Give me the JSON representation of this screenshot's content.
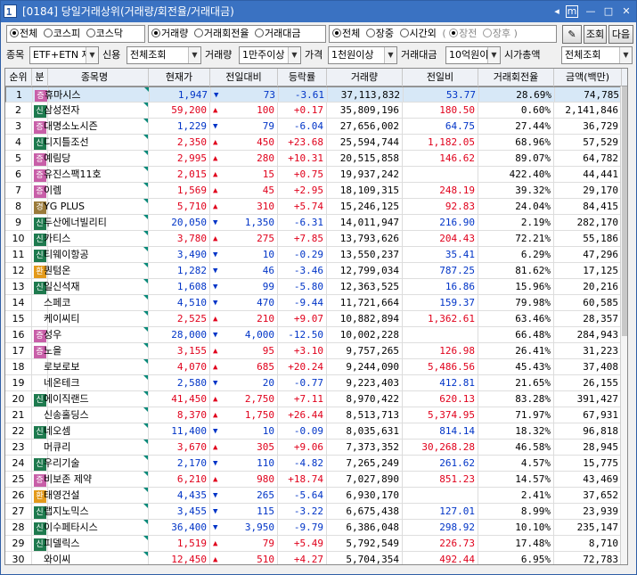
{
  "window": {
    "number": "1",
    "title": "[0184] 당일거래상위(거래량/회전율/거래대금)",
    "controls": [
      "◂",
      "▸",
      "m",
      "—",
      "□",
      "✕"
    ]
  },
  "market_group": {
    "options": [
      "전체",
      "코스피",
      "코스닥"
    ],
    "selected": 0
  },
  "sort_group": {
    "options": [
      "거래량",
      "거래회전율",
      "거래대금"
    ],
    "selected": 0
  },
  "session_group": {
    "options": [
      "전체",
      "장중",
      "시간외"
    ],
    "selected": 0
  },
  "sub_session": {
    "open": "(",
    "options": [
      "장전",
      "장후"
    ],
    "close": ")"
  },
  "buttons": {
    "settings_icon": "✎",
    "search": "조회",
    "next": "다음"
  },
  "filters": {
    "item_label": "종목",
    "item_value": "ETF+ETN 제",
    "credit_label": "신용",
    "credit_value": "전체조회",
    "volume_label": "거래량",
    "volume_value": "1만주이상",
    "price_label": "가격",
    "price_value": "1천원이상",
    "amount_label": "거래대금",
    "amount_value": "10억원이상",
    "cap_label": "시가총액",
    "cap_value": "전체조회"
  },
  "columns": [
    "순위",
    "분",
    "종목명",
    "현재가",
    "전일대비",
    "등락률",
    "거래량",
    "전일비",
    "거래회전율",
    "금액(백만)"
  ],
  "colors": {
    "up": "#e0001b",
    "down": "#0034c7",
    "badge_jeung": "#c85fa8",
    "badge_sin": "#1e7a4e",
    "badge_gyeong": "#9a7a3a",
    "badge_hwan": "#e39a1b"
  },
  "rows": [
    {
      "rank": "1",
      "badge": "증",
      "name": "휴마시스",
      "price": "1,947",
      "dir": "down",
      "change": "73",
      "rate": "-3.61",
      "volume": "37,113,832",
      "prev_ratio": "53.77",
      "turnover": "28.69%",
      "amount": "74,785"
    },
    {
      "rank": "2",
      "badge": "신",
      "name": "삼성전자",
      "price": "59,200",
      "dir": "up",
      "change": "100",
      "rate": "+0.17",
      "volume": "35,809,196",
      "prev_ratio": "180.50",
      "turnover": "0.60%",
      "amount": "2,141,846"
    },
    {
      "rank": "3",
      "badge": "증",
      "name": "대명소노시즌",
      "price": "1,229",
      "dir": "down",
      "change": "79",
      "rate": "-6.04",
      "volume": "27,656,002",
      "prev_ratio": "64.75",
      "turnover": "27.44%",
      "amount": "36,729"
    },
    {
      "rank": "4",
      "badge": "신",
      "name": "디지틀조선",
      "price": "2,350",
      "dir": "up",
      "change": "450",
      "rate": "+23.68",
      "volume": "25,594,744",
      "prev_ratio": "1,182.05",
      "turnover": "68.96%",
      "amount": "57,529"
    },
    {
      "rank": "5",
      "badge": "증",
      "name": "예림당",
      "price": "2,995",
      "dir": "up",
      "change": "280",
      "rate": "+10.31",
      "volume": "20,515,858",
      "prev_ratio": "146.62",
      "turnover": "89.07%",
      "amount": "64,782"
    },
    {
      "rank": "6",
      "badge": "증",
      "name": "유진스팩11호",
      "price": "2,015",
      "dir": "up",
      "change": "15",
      "rate": "+0.75",
      "volume": "19,937,242",
      "prev_ratio": "",
      "turnover": "422.40%",
      "amount": "44,441"
    },
    {
      "rank": "7",
      "badge": "증",
      "name": "이렘",
      "price": "1,569",
      "dir": "up",
      "change": "45",
      "rate": "+2.95",
      "volume": "18,109,315",
      "prev_ratio": "248.19",
      "turnover": "39.32%",
      "amount": "29,170"
    },
    {
      "rank": "8",
      "badge": "경",
      "name": "YG PLUS",
      "price": "5,710",
      "dir": "up",
      "change": "310",
      "rate": "+5.74",
      "volume": "15,246,125",
      "prev_ratio": "92.83",
      "turnover": "24.04%",
      "amount": "84,415"
    },
    {
      "rank": "9",
      "badge": "신",
      "name": "두산에너빌리티",
      "price": "20,050",
      "dir": "down",
      "change": "1,350",
      "rate": "-6.31",
      "volume": "14,011,947",
      "prev_ratio": "216.90",
      "turnover": "2.19%",
      "amount": "282,170"
    },
    {
      "rank": "10",
      "badge": "신",
      "name": "카티스",
      "price": "3,780",
      "dir": "up",
      "change": "275",
      "rate": "+7.85",
      "volume": "13,793,626",
      "prev_ratio": "204.43",
      "turnover": "72.21%",
      "amount": "55,186"
    },
    {
      "rank": "11",
      "badge": "신",
      "name": "티웨이항공",
      "price": "3,490",
      "dir": "down",
      "change": "10",
      "rate": "-0.29",
      "volume": "13,550,237",
      "prev_ratio": "35.41",
      "turnover": "6.29%",
      "amount": "47,296"
    },
    {
      "rank": "12",
      "badge": "환",
      "name": "퀀텀온",
      "price": "1,282",
      "dir": "down",
      "change": "46",
      "rate": "-3.46",
      "volume": "12,799,034",
      "prev_ratio": "787.25",
      "turnover": "81.62%",
      "amount": "17,125"
    },
    {
      "rank": "13",
      "badge": "신",
      "name": "일신석재",
      "price": "1,608",
      "dir": "down",
      "change": "99",
      "rate": "-5.80",
      "volume": "12,363,525",
      "prev_ratio": "16.86",
      "turnover": "15.96%",
      "amount": "20,216"
    },
    {
      "rank": "14",
      "badge": "",
      "name": "스페코",
      "price": "4,510",
      "dir": "down",
      "change": "470",
      "rate": "-9.44",
      "volume": "11,721,664",
      "prev_ratio": "159.37",
      "turnover": "79.98%",
      "amount": "60,585"
    },
    {
      "rank": "15",
      "badge": "",
      "name": "케이씨티",
      "price": "2,525",
      "dir": "up",
      "change": "210",
      "rate": "+9.07",
      "volume": "10,882,894",
      "prev_ratio": "1,362.61",
      "turnover": "63.46%",
      "amount": "28,357"
    },
    {
      "rank": "16",
      "badge": "증",
      "name": "성우",
      "price": "28,000",
      "dir": "down",
      "change": "4,000",
      "rate": "-12.50",
      "volume": "10,002,228",
      "prev_ratio": "",
      "turnover": "66.48%",
      "amount": "284,943"
    },
    {
      "rank": "17",
      "badge": "증",
      "name": "노을",
      "price": "3,155",
      "dir": "up",
      "change": "95",
      "rate": "+3.10",
      "volume": "9,757,265",
      "prev_ratio": "126.98",
      "turnover": "26.41%",
      "amount": "31,223"
    },
    {
      "rank": "18",
      "badge": "",
      "name": "로보로보",
      "price": "4,070",
      "dir": "up",
      "change": "685",
      "rate": "+20.24",
      "volume": "9,244,090",
      "prev_ratio": "5,486.56",
      "turnover": "45.43%",
      "amount": "37,408"
    },
    {
      "rank": "19",
      "badge": "",
      "name": "네온테크",
      "price": "2,580",
      "dir": "down",
      "change": "20",
      "rate": "-0.77",
      "volume": "9,223,403",
      "prev_ratio": "412.81",
      "turnover": "21.65%",
      "amount": "26,155"
    },
    {
      "rank": "20",
      "badge": "신",
      "name": "에이직랜드",
      "price": "41,450",
      "dir": "up",
      "change": "2,750",
      "rate": "+7.11",
      "volume": "8,970,422",
      "prev_ratio": "620.13",
      "turnover": "83.28%",
      "amount": "391,427"
    },
    {
      "rank": "21",
      "badge": "",
      "name": "신송홀딩스",
      "price": "8,370",
      "dir": "up",
      "change": "1,750",
      "rate": "+26.44",
      "volume": "8,513,713",
      "prev_ratio": "5,374.95",
      "turnover": "71.97%",
      "amount": "67,931"
    },
    {
      "rank": "22",
      "badge": "신",
      "name": "네오셈",
      "price": "11,400",
      "dir": "down",
      "change": "10",
      "rate": "-0.09",
      "volume": "8,035,631",
      "prev_ratio": "814.14",
      "turnover": "18.32%",
      "amount": "96,818"
    },
    {
      "rank": "23",
      "badge": "",
      "name": "머큐리",
      "price": "3,670",
      "dir": "up",
      "change": "305",
      "rate": "+9.06",
      "volume": "7,373,352",
      "prev_ratio": "30,268.28",
      "turnover": "46.58%",
      "amount": "28,945"
    },
    {
      "rank": "24",
      "badge": "신",
      "name": "우리기술",
      "price": "2,170",
      "dir": "down",
      "change": "110",
      "rate": "-4.82",
      "volume": "7,265,249",
      "prev_ratio": "261.62",
      "turnover": "4.57%",
      "amount": "15,775"
    },
    {
      "rank": "25",
      "badge": "증",
      "name": "비보존 제약",
      "price": "6,210",
      "dir": "up",
      "change": "980",
      "rate": "+18.74",
      "volume": "7,027,890",
      "prev_ratio": "851.23",
      "turnover": "14.57%",
      "amount": "43,469"
    },
    {
      "rank": "26",
      "badge": "환",
      "name": "태영건설",
      "price": "4,435",
      "dir": "down",
      "change": "265",
      "rate": "-5.64",
      "volume": "6,930,170",
      "prev_ratio": "",
      "turnover": "2.41%",
      "amount": "37,652"
    },
    {
      "rank": "27",
      "badge": "신",
      "name": "랩지노믹스",
      "price": "3,455",
      "dir": "down",
      "change": "115",
      "rate": "-3.22",
      "volume": "6,675,438",
      "prev_ratio": "127.01",
      "turnover": "8.99%",
      "amount": "23,939"
    },
    {
      "rank": "28",
      "badge": "신",
      "name": "이수페타시스",
      "price": "36,400",
      "dir": "down",
      "change": "3,950",
      "rate": "-9.79",
      "volume": "6,386,048",
      "prev_ratio": "298.92",
      "turnover": "10.10%",
      "amount": "235,147"
    },
    {
      "rank": "29",
      "badge": "신",
      "name": "피델릭스",
      "price": "1,519",
      "dir": "up",
      "change": "79",
      "rate": "+5.49",
      "volume": "5,792,549",
      "prev_ratio": "226.73",
      "turnover": "17.48%",
      "amount": "8,710"
    },
    {
      "rank": "30",
      "badge": "",
      "name": "와이씨",
      "price": "12,450",
      "dir": "up",
      "change": "510",
      "rate": "+4.27",
      "volume": "5,704,354",
      "prev_ratio": "492.44",
      "turnover": "6.95%",
      "amount": "72,783"
    }
  ]
}
